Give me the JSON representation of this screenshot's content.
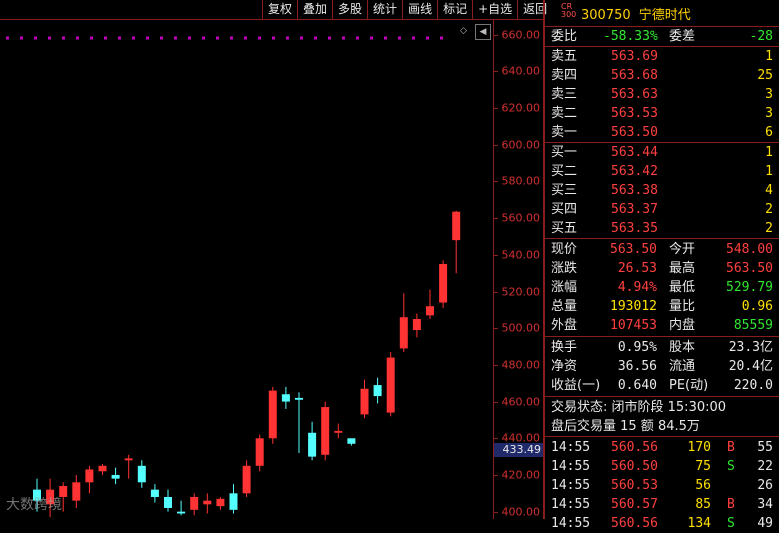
{
  "toolbar": [
    "复权",
    "叠加",
    "多股",
    "统计",
    "画线",
    "标记",
    "+自选",
    "返回"
  ],
  "chart": {
    "y_labels": [
      "660.00",
      "640.00",
      "620.00",
      "600.00",
      "580.00",
      "560.00",
      "540.00",
      "520.00",
      "500.00",
      "480.00",
      "460.00",
      "440.00",
      "420.00",
      "400.00"
    ],
    "cursor_price": "433.49",
    "collapse_glyph": "◇",
    "watermark": "大数跨境",
    "colors": {
      "up": "#ff3333",
      "down": "#54ffff",
      "axis": "#8a1c1c",
      "dots": "#c000c0"
    }
  },
  "chart_data": {
    "type": "candlestick",
    "ylim": [
      396,
      668
    ],
    "candles": [
      {
        "o": 412,
        "h": 418,
        "l": 400,
        "c": 406
      },
      {
        "o": 404,
        "h": 418,
        "l": 397,
        "c": 412
      },
      {
        "o": 408,
        "h": 416,
        "l": 400,
        "c": 414
      },
      {
        "o": 406,
        "h": 420,
        "l": 402,
        "c": 416
      },
      {
        "o": 416,
        "h": 425,
        "l": 410,
        "c": 423
      },
      {
        "o": 422,
        "h": 426,
        "l": 420,
        "c": 425
      },
      {
        "o": 420,
        "h": 424,
        "l": 415,
        "c": 418
      },
      {
        "o": 428,
        "h": 431,
        "l": 418,
        "c": 429
      },
      {
        "o": 425,
        "h": 428,
        "l": 413,
        "c": 416
      },
      {
        "o": 412,
        "h": 415,
        "l": 405,
        "c": 408
      },
      {
        "o": 408,
        "h": 412,
        "l": 400,
        "c": 402
      },
      {
        "o": 400,
        "h": 406,
        "l": 398,
        "c": 399
      },
      {
        "o": 401,
        "h": 410,
        "l": 398,
        "c": 408
      },
      {
        "o": 404,
        "h": 410,
        "l": 399,
        "c": 406
      },
      {
        "o": 403,
        "h": 408,
        "l": 401,
        "c": 407
      },
      {
        "o": 410,
        "h": 415,
        "l": 399,
        "c": 401
      },
      {
        "o": 410,
        "h": 428,
        "l": 408,
        "c": 425
      },
      {
        "o": 425,
        "h": 442,
        "l": 422,
        "c": 440
      },
      {
        "o": 440,
        "h": 468,
        "l": 437,
        "c": 466
      },
      {
        "o": 464,
        "h": 468,
        "l": 456,
        "c": 460
      },
      {
        "o": 462,
        "h": 465,
        "l": 432,
        "c": 461
      },
      {
        "o": 443,
        "h": 449,
        "l": 428,
        "c": 430
      },
      {
        "o": 431,
        "h": 460,
        "l": 428,
        "c": 457
      },
      {
        "o": 443,
        "h": 448,
        "l": 440,
        "c": 444
      },
      {
        "o": 440,
        "h": 438,
        "l": 436,
        "c": 437
      },
      {
        "o": 453,
        "h": 472,
        "l": 451,
        "c": 467
      },
      {
        "o": 469,
        "h": 473,
        "l": 459,
        "c": 463
      },
      {
        "o": 454,
        "h": 487,
        "l": 452,
        "c": 484
      },
      {
        "o": 489,
        "h": 519,
        "l": 487,
        "c": 506
      },
      {
        "o": 499,
        "h": 508,
        "l": 495,
        "c": 505
      },
      {
        "o": 507,
        "h": 521,
        "l": 505,
        "c": 512
      },
      {
        "o": 514,
        "h": 537,
        "l": 511,
        "c": 535
      },
      {
        "o": 548,
        "h": 564,
        "l": 530,
        "c": 563.5
      }
    ]
  },
  "panel": {
    "badge_top": "CR",
    "badge_bottom": "300",
    "code": "300750",
    "name": "宁德时代",
    "wei_bi_label": "委比",
    "wei_bi": "-58.33%",
    "wei_cha_label": "委差",
    "wei_cha": "-28",
    "sell": [
      {
        "label": "卖五",
        "price": "563.69",
        "vol": "1"
      },
      {
        "label": "卖四",
        "price": "563.68",
        "vol": "25"
      },
      {
        "label": "卖三",
        "price": "563.63",
        "vol": "3"
      },
      {
        "label": "卖二",
        "price": "563.53",
        "vol": "3"
      },
      {
        "label": "卖一",
        "price": "563.50",
        "vol": "6"
      }
    ],
    "buy": [
      {
        "label": "买一",
        "price": "563.44",
        "vol": "1"
      },
      {
        "label": "买二",
        "price": "563.42",
        "vol": "1"
      },
      {
        "label": "买三",
        "price": "563.38",
        "vol": "4"
      },
      {
        "label": "买四",
        "price": "563.37",
        "vol": "2"
      },
      {
        "label": "买五",
        "price": "563.35",
        "vol": "2"
      }
    ],
    "stats": [
      {
        "l1": "现价",
        "v1": "563.50",
        "c1": "red",
        "l2": "今开",
        "v2": "548.00",
        "c2": "red"
      },
      {
        "l1": "涨跌",
        "v1": "26.53",
        "c1": "red",
        "l2": "最高",
        "v2": "563.50",
        "c2": "red"
      },
      {
        "l1": "涨幅",
        "v1": "4.94%",
        "c1": "red",
        "l2": "最低",
        "v2": "529.79",
        "c2": "green"
      },
      {
        "l1": "总量",
        "v1": "193012",
        "c1": "yellow",
        "l2": "量比",
        "v2": "0.96",
        "c2": "yellow"
      },
      {
        "l1": "外盘",
        "v1": "107453",
        "c1": "red",
        "l2": "内盘",
        "v2": "85559",
        "c2": "green"
      }
    ],
    "stats2": [
      {
        "l1": "换手",
        "v1": "0.95%",
        "l2": "股本",
        "v2": "23.3亿"
      },
      {
        "l1": "净资",
        "v1": "36.56",
        "l2": "流通",
        "v2": "20.4亿"
      },
      {
        "l1": "收益(一)",
        "v1": "0.640",
        "l2": "PE(动)",
        "v2": "220.0"
      }
    ],
    "trade_status": "交易状态: 闭市阶段 15:30:00",
    "after_hours": "盘后交易量 15 额 84.5万",
    "ticks": [
      {
        "time": "14:55",
        "price": "560.56",
        "vol": "170",
        "bs": "B",
        "n": "55"
      },
      {
        "time": "14:55",
        "price": "560.50",
        "vol": "75",
        "bs": "S",
        "n": "22"
      },
      {
        "time": "14:55",
        "price": "560.53",
        "vol": "56",
        "bs": "",
        "n": "26"
      },
      {
        "time": "14:55",
        "price": "560.57",
        "vol": "85",
        "bs": "B",
        "n": "34"
      },
      {
        "time": "14:55",
        "price": "560.56",
        "vol": "134",
        "bs": "S",
        "n": "49"
      }
    ]
  }
}
